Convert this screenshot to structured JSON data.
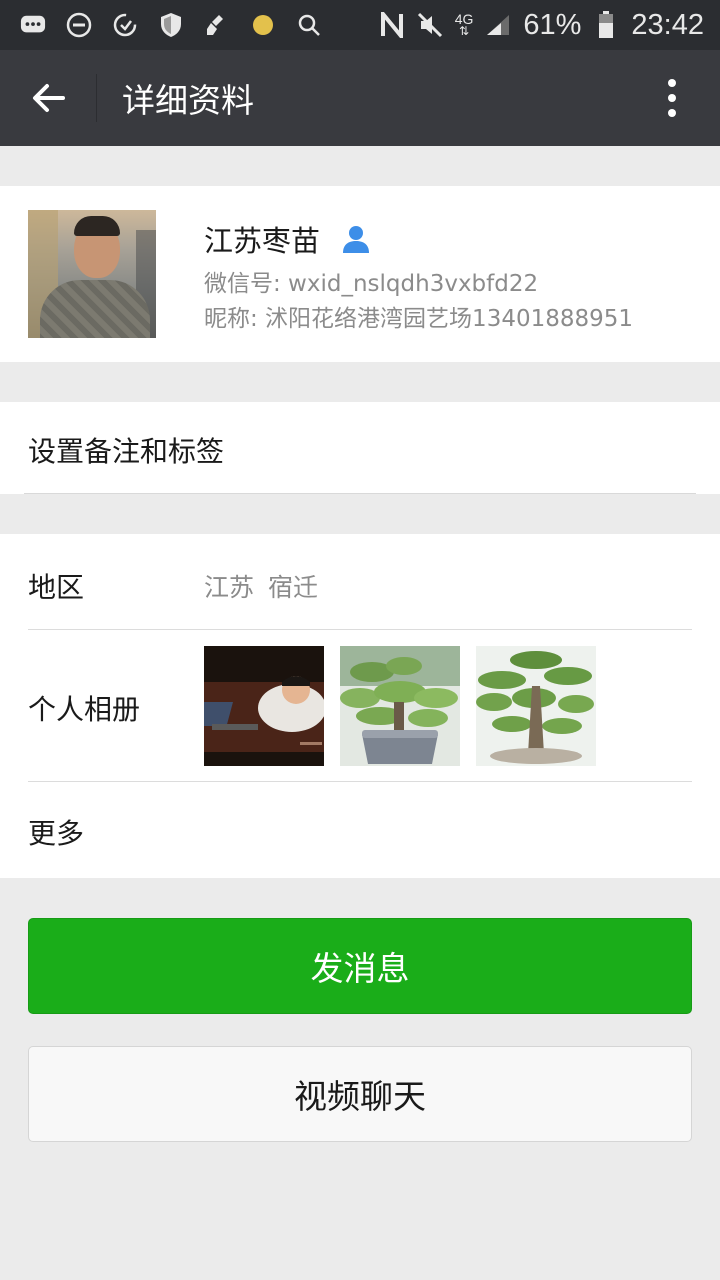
{
  "status_bar": {
    "battery": "61%",
    "time": "23:42",
    "network": "4G",
    "icons": [
      "message-icon",
      "do-not-disturb-icon",
      "sync-icon",
      "shield-icon",
      "cleaner-icon",
      "dot-icon",
      "search-icon",
      "nfc-icon",
      "mute-icon",
      "signal-icon",
      "battery-icon"
    ]
  },
  "topbar": {
    "title": "详细资料",
    "back_icon": "back-arrow-icon",
    "more_icon": "more-vertical-icon"
  },
  "profile": {
    "name": "江苏枣苗",
    "wechat_id": "微信号: wxid_nslqdh3vxbfd22",
    "nickname": "昵称: 沭阳花络港湾园艺场13401888951",
    "gender_icon": "male-user-icon",
    "gender_color": "#3d8ee8"
  },
  "remark": {
    "label": "设置备注和标签"
  },
  "info": {
    "region_label": "地区",
    "region_value": "江苏  宿迁",
    "album_label": "个人相册",
    "more_label": "更多"
  },
  "actions": {
    "send_message": "发消息",
    "video_chat": "视频聊天",
    "primary_color": "#1aad19"
  }
}
